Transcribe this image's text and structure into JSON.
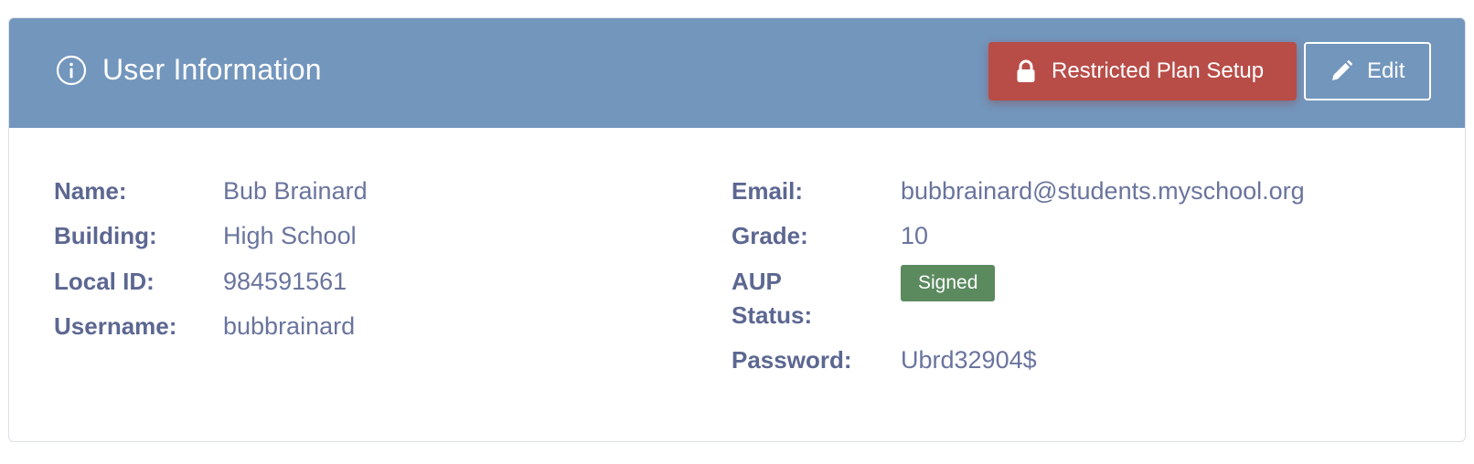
{
  "header": {
    "title": "User Information",
    "info_icon": "info-circle-icon",
    "restricted_button": {
      "label": "Restricted Plan Setup",
      "icon": "lock-icon",
      "color": "#b84d48"
    },
    "edit_button": {
      "label": "Edit",
      "icon": "pencil-icon"
    },
    "color": "#7396bd"
  },
  "left_fields": [
    {
      "label": "Name:",
      "value": "Bub Brainard"
    },
    {
      "label": "Building:",
      "value": "High School"
    },
    {
      "label": "Local ID:",
      "value": "984591561"
    },
    {
      "label": "Username:",
      "value": "bubbrainard"
    }
  ],
  "right_fields": {
    "email": {
      "label": "Email:",
      "value": "bubbrainard@students.myschool.org"
    },
    "grade": {
      "label": "Grade:",
      "value": "10"
    },
    "aup": {
      "label_line1": "AUP",
      "label_line2": "Status:",
      "value": "Signed",
      "color": "#5b8a5f"
    },
    "password": {
      "label": "Password:",
      "value": "Ubrd32904$"
    }
  }
}
